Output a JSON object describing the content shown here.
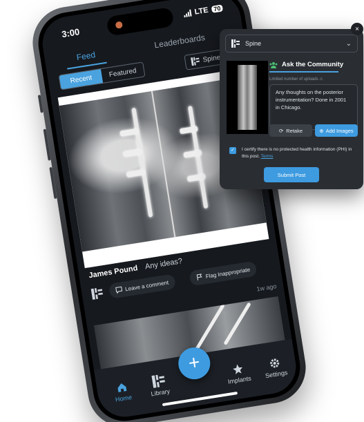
{
  "phone": {
    "status": {
      "time": "3:00",
      "network": "LTE",
      "battery": "70"
    },
    "nav": {
      "tab_feed": "Feed",
      "tab_leaderboards": "Leaderboards"
    },
    "filters": {
      "recent": "Recent",
      "featured": "Featured",
      "category": "Spine"
    },
    "post": {
      "author": "James Pound",
      "caption": "Any ideas?",
      "comment_label": "Leave a comment",
      "flag_label": "Flag Inappropriate",
      "time_ago": "1w ago"
    },
    "tabbar": {
      "home": "Home",
      "library": "Library",
      "implants": "Implants",
      "settings": "Settings",
      "fab": "+"
    }
  },
  "card": {
    "close": "×",
    "category": "Spine",
    "community_title": "Ask the Community",
    "upload_limit": "Limited number of uploads",
    "post_text": "Any thoughts on the posterior instrumentation? Done in 2001 in Chicago.",
    "retake_label": "Retake",
    "add_images_label": "Add Images",
    "certify_text": "I certify there is no protected health information (PHI) in this post.",
    "terms_label": "Terms",
    "submit_label": "Submit Post",
    "accent": "#3e9be0"
  }
}
